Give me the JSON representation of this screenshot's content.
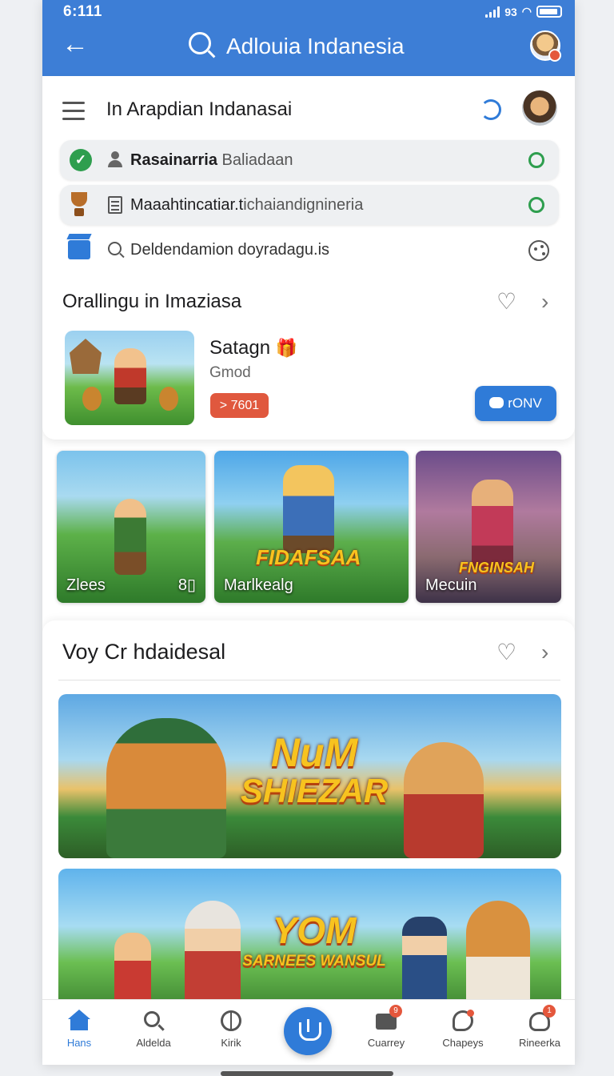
{
  "status": {
    "time": "6:111",
    "net": "93"
  },
  "appbar": {
    "title": "Adlouia Indanesia"
  },
  "card1": {
    "title": "In Arapdian Indanasai",
    "rows": [
      {
        "bold": "Rasainarria",
        "rest": "Baliadaan"
      },
      {
        "bold": "Maaahtincatiar.t",
        "rest": "ichaiandignineria"
      }
    ],
    "search_text": "Deldendamion doyradagu.is",
    "section_title": "Orallingu in Imaziasa",
    "game": {
      "name": "Satagn",
      "sub": "Gmod",
      "badge": "> 7601",
      "button": "rONV"
    }
  },
  "tiles": [
    {
      "caption": "Zlees",
      "count": "8▯"
    },
    {
      "caption": "Marlkealg",
      "banner": "FIDAFSAA"
    },
    {
      "caption": "Mecuin",
      "banner": "FNGINSAH"
    }
  ],
  "card2": {
    "title": "Voy Cr hdaidesal",
    "banners": [
      {
        "line1": "NuM",
        "line2": "SHIEZAR"
      },
      {
        "line1": "YOM",
        "line2": "SARNEES WANSUL"
      }
    ]
  },
  "nav": [
    {
      "label": "Hans",
      "icon": "home-icon",
      "active": true
    },
    {
      "label": "Aldelda",
      "icon": "search-icon"
    },
    {
      "label": "Kirik",
      "icon": "globe-icon"
    },
    {
      "label": "Cuarrey",
      "icon": "card-icon",
      "badge": "9"
    },
    {
      "label": "Chapeys",
      "icon": "chat-icon"
    },
    {
      "label": "Rineerka",
      "icon": "profile-icon",
      "badge": "1"
    }
  ],
  "colors": {
    "accent": "#3d7ed6",
    "success": "#2e9e4e",
    "alert": "#e0583e"
  }
}
